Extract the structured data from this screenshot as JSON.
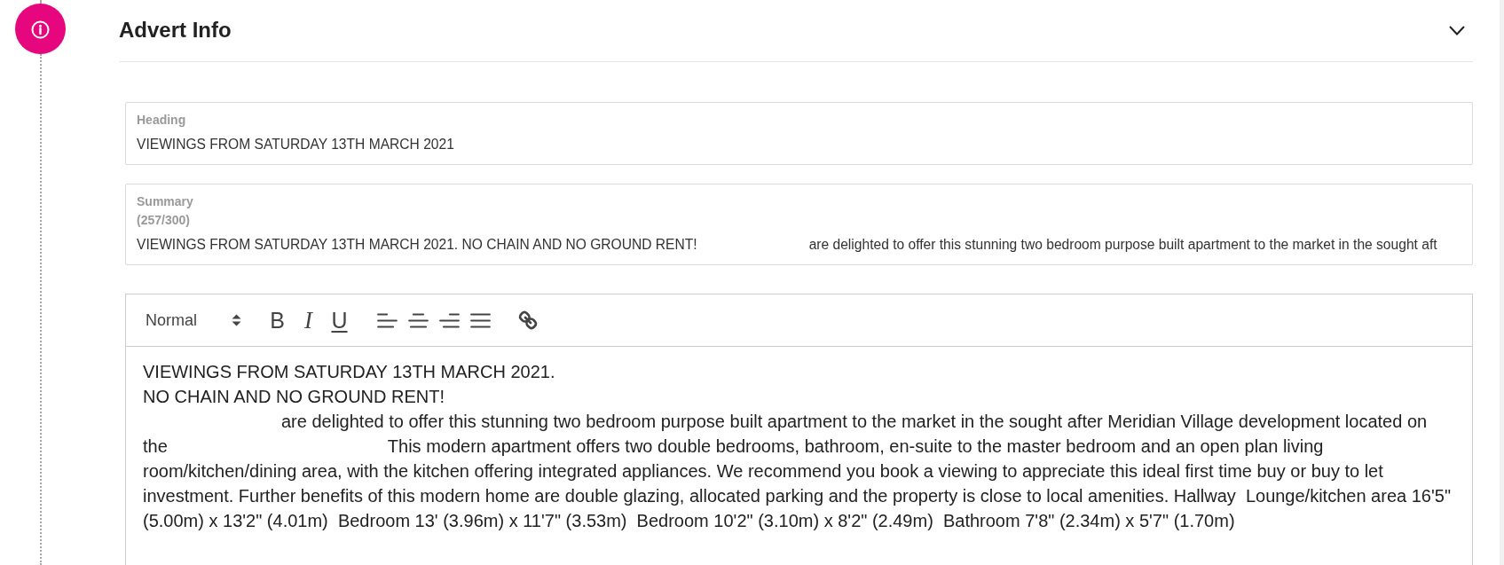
{
  "section": {
    "title": "Advert Info"
  },
  "fields": [
    {
      "label": "Heading",
      "value": [
        {
          "kind": "text",
          "text": "VIEWINGS FROM SATURDAY 13TH MARCH 2021"
        }
      ]
    },
    {
      "label": "Summary",
      "count": "(257/300)",
      "value": [
        {
          "kind": "text",
          "text": "VIEWINGS FROM SATURDAY 13TH MARCH 2021. NO CHAIN AND NO GROUND RENT!"
        },
        {
          "kind": "blank"
        },
        {
          "kind": "text",
          "text": "are delighted to offer this stunning two bedroom purpose built apartment to the market in the sought aft"
        }
      ]
    }
  ],
  "editor": {
    "toolbar": {
      "format": "Normal",
      "groups": [
        [
          {
            "kind": "bold",
            "label": "B"
          },
          {
            "kind": "italic",
            "label": "I"
          },
          {
            "kind": "underline",
            "label": "U"
          }
        ],
        [
          {
            "kind": "align-left"
          },
          {
            "kind": "align-center"
          },
          {
            "kind": "align-right"
          },
          {
            "kind": "align-justify"
          }
        ],
        [
          {
            "kind": "link"
          }
        ]
      ]
    },
    "paragraphs": [
      {
        "lines": [
          [
            {
              "kind": "text",
              "text": "VIEWINGS FROM SATURDAY 13TH MARCH 2021."
            }
          ]
        ]
      },
      {
        "lines": [
          [
            {
              "kind": "text",
              "text": "NO CHAIN AND NO GROUND RENT!"
            }
          ]
        ]
      },
      {
        "lines": [
          [
            {
              "kind": "blank"
            },
            {
              "kind": "text",
              "text": "are delighted to offer this stunning two bedroom purpose built apartment to the market in the sought after Meridian Village development located on"
            }
          ],
          [
            {
              "kind": "text",
              "text": "the"
            },
            {
              "kind": "blank"
            },
            {
              "kind": "text",
              "text": "This modern apartment offers two double bedrooms, bathroom, en-suite to the master bedroom and an open plan living"
            }
          ],
          [
            {
              "kind": "text",
              "text": "room/kitchen/dining area, with the kitchen offering integrated appliances. We recommend you book a viewing to appreciate this ideal first time buy or buy to let"
            }
          ],
          [
            {
              "kind": "text",
              "text": "investment. Further benefits of this modern home are double glazing, allocated parking and the property is close to local amenities. Hallway  Lounge/kitchen area 16'5\""
            }
          ],
          [
            {
              "kind": "text",
              "text": "(5.00m) x 13'2\" (4.01m)  Bedroom 13' (3.96m) x 11'7\" (3.53m)  Bedroom 10'2\" (3.10m) x 8'2\" (2.49m)  Bathroom 7'8\" (2.34m) x 5'7\" (1.70m)"
            }
          ]
        ]
      }
    ]
  }
}
